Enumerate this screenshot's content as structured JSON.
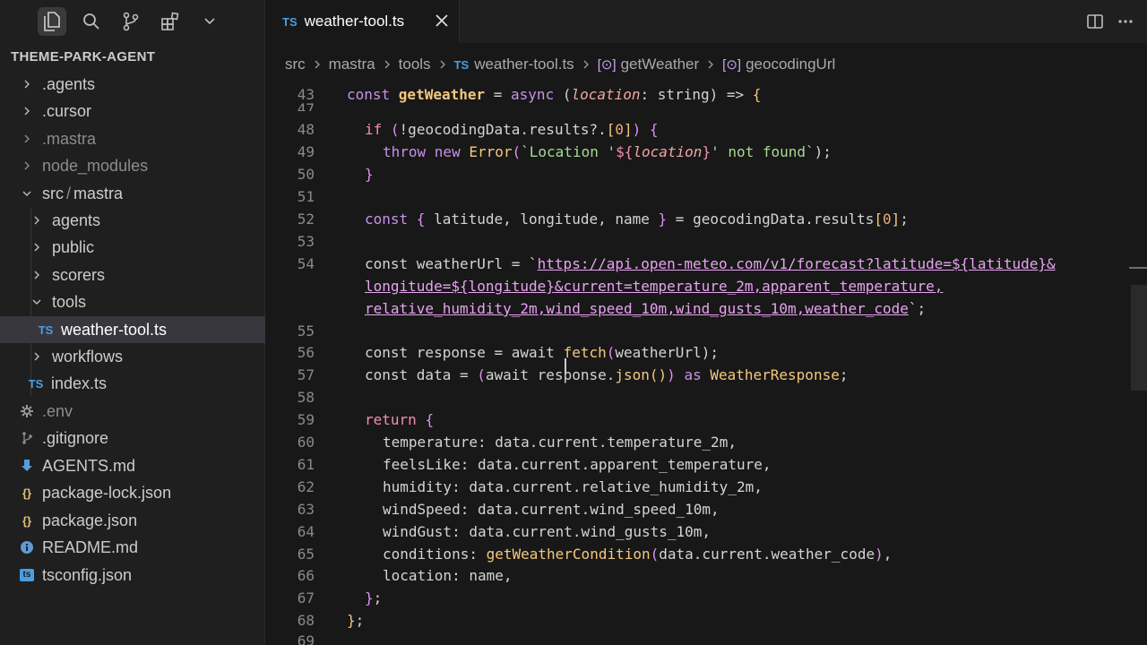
{
  "sidebar": {
    "title": "THEME-PARK-AGENT",
    "items": [
      {
        "label": ".agents"
      },
      {
        "label": ".cursor"
      },
      {
        "label": ".mastra"
      },
      {
        "label": "node_modules"
      },
      {
        "label": "src",
        "label2": "mastra"
      },
      {
        "label": "agents"
      },
      {
        "label": "public"
      },
      {
        "label": "scorers"
      },
      {
        "label": "tools"
      },
      {
        "label": "weather-tool.ts"
      },
      {
        "label": "workflows"
      },
      {
        "label": "index.ts"
      },
      {
        "label": ".env"
      },
      {
        "label": ".gitignore"
      },
      {
        "label": "AGENTS.md"
      },
      {
        "label": "package-lock.json"
      },
      {
        "label": "package.json"
      },
      {
        "label": "README.md"
      },
      {
        "label": "tsconfig.json"
      }
    ],
    "ts_badge": "TS",
    "json_badge": "{}",
    "tsconfig_badge": "ts"
  },
  "tab": {
    "badge": "TS",
    "name": "weather-tool.ts"
  },
  "breadcrumb": [
    "src",
    "mastra",
    "tools",
    "weather-tool.ts",
    "getWeather",
    "geocodingUrl"
  ],
  "code": {
    "line_numbers": [
      "43",
      "47",
      "48",
      "49",
      "50",
      "51",
      "52",
      "53",
      "54",
      "",
      "",
      "55",
      "56",
      "57",
      "58",
      "59",
      "60",
      "61",
      "62",
      "63",
      "64",
      "65",
      "66",
      "67",
      "68",
      "69"
    ],
    "l43": {
      "a": "const ",
      "b": "getWeather",
      "c": " = ",
      "d": "async",
      "e": " (",
      "f": "location",
      "g": ": string) => ",
      "h": "{"
    },
    "l48": {
      "a": "if ",
      "b": "(",
      "c": "!geocodingData.results?.",
      "d": "[",
      "e": "0",
      "f": "]",
      "g": ")",
      "h": " {"
    },
    "l49": {
      "a": "throw new ",
      "b": "Error",
      "c": "(",
      "d": "`Location '",
      "e": "${",
      "f": "location",
      "g": "}",
      "h": "' not found`",
      "i": ");"
    },
    "l50": "}",
    "l52": {
      "a": "const ",
      "b": "{",
      "c": " latitude, longitude, name ",
      "d": "}",
      "e": " = geocodingData.results",
      "f": "[",
      "g": "0",
      "h": "]",
      "i": ";"
    },
    "l54": {
      "a": "const weatherUrl = `",
      "b": "https://api.open-meteo.com/v1/forecast?latitude=${latitude}&"
    },
    "l54b": "longitude=${longitude}&current=temperature_2m,apparent_temperature,",
    "l54c": {
      "a": "relative_humidity_2m,wind_speed_10m,wind_gusts_10m,weather_code",
      "b": "`;"
    },
    "l56": {
      "a": "const response = await ",
      "b": "fetch",
      "c": "(",
      "d": "weatherUrl",
      "e": ");"
    },
    "l57": {
      "a": "const data = ",
      "b": "(",
      "c": "await response.",
      "d": "json",
      "e": "()",
      "f": ")",
      "g": " as ",
      "h": "WeatherResponse",
      "i": ";"
    },
    "l59": {
      "a": "return ",
      "b": "{"
    },
    "l60": {
      "a": "temperature",
      "b": ": data.current.temperature_2m,"
    },
    "l61": {
      "a": "feelsLike",
      "b": ": data.current.apparent_temperature,"
    },
    "l62": {
      "a": "humidity",
      "b": ": data.current.relative_humidity_2m,"
    },
    "l63": {
      "a": "windSpeed",
      "b": ": data.current.wind_speed_10m,"
    },
    "l64": {
      "a": "windGust",
      "b": ": data.current.wind_gusts_10m,"
    },
    "l65": {
      "a": "conditions",
      "b": ": ",
      "c": "getWeatherCondition",
      "d": "(",
      "e": "data.current.weather_code",
      "f": ")",
      "g": ","
    },
    "l66": {
      "a": "location",
      "b": ": name,"
    },
    "l67": {
      "a": "}",
      "b": ";"
    },
    "l68": {
      "a": "}",
      "b": ";"
    }
  },
  "colors": {
    "keyword": "#f28fad",
    "function": "#f5c77e",
    "string": "#a6da95",
    "url": "#e7a3f0",
    "ts_badge": "#4b9de0"
  },
  "icons": [
    "files-icon",
    "search-icon",
    "source-control-icon",
    "extensions-icon",
    "chevron-down-icon",
    "split-editor-icon",
    "more-icon",
    "close-icon"
  ]
}
